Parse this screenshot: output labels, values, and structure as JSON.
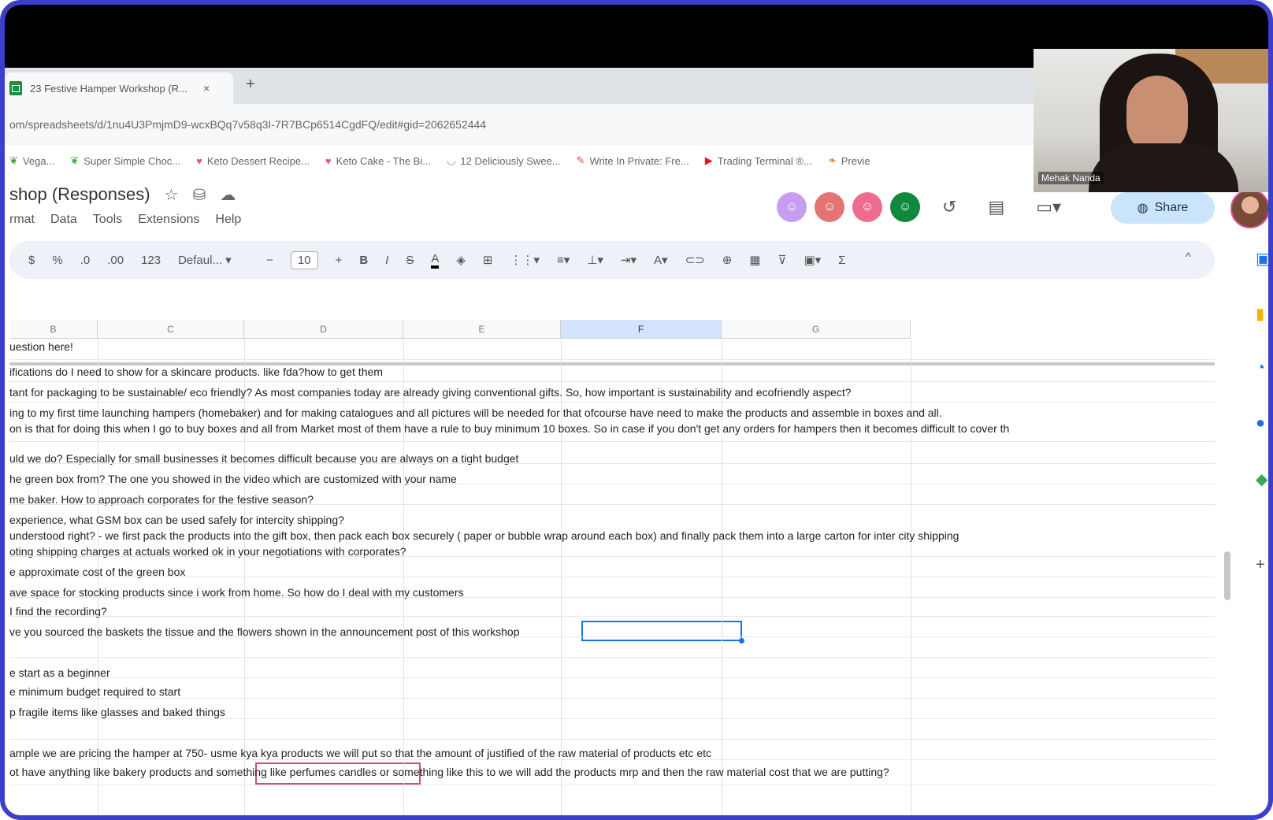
{
  "browser": {
    "tab_title": "23 Festive Hamper Workshop (R...",
    "tab_close": "×",
    "new_tab": "+",
    "url": "om/spreadsheets/d/1nu4U3PmjmD9-wcxBQq7v58q3I-7R7BCp6514CgdFQ/edit#gid=2062652444",
    "bookmarks": [
      {
        "icon": "leaf-icon",
        "label": "Vega...",
        "color": "#4a9d3c"
      },
      {
        "icon": "leaf-icon",
        "label": "Super Simple Choc...",
        "color": "#3bb03b"
      },
      {
        "icon": "heart-icon",
        "label": "Keto Dessert Recipe...",
        "color": "#e0569a"
      },
      {
        "icon": "heart-icon",
        "label": "Keto Cake - The Bi...",
        "color": "#e0569a"
      },
      {
        "icon": "bowl-icon",
        "label": "12 Deliciously Swee...",
        "color": "#888888"
      },
      {
        "icon": "pen-icon",
        "label": "Write In Private: Fre...",
        "color": "#e64a2e"
      },
      {
        "icon": "youtube-icon",
        "label": "Trading Terminal ®...",
        "color": "#e31b1b"
      },
      {
        "icon": "flame-icon",
        "label": "Previe",
        "color": "#f07b1c"
      }
    ]
  },
  "sheet": {
    "title": "shop (Responses)",
    "menus": [
      "rmat",
      "Data",
      "Tools",
      "Extensions",
      "Help"
    ],
    "share_label": "Share",
    "collaborators": [
      {
        "icon": "avatar-icon",
        "color": "#c79df1"
      },
      {
        "icon": "avatar-icon",
        "color": "#e57373"
      },
      {
        "icon": "avatar-icon",
        "color": "#ef6c8f"
      },
      {
        "icon": "avatar-icon",
        "color": "#0f8a3c"
      }
    ],
    "toolbar": {
      "currency": "$",
      "percent": "%",
      "number_format": "123",
      "font": "Defaul...",
      "font_size": "10",
      "minus": "−",
      "plus": "+",
      "bold": "B",
      "italic": "I",
      "strike": "S",
      "text_color": "A",
      "sum": "Σ",
      "collapse": "^"
    },
    "columns": [
      "B",
      "C",
      "D",
      "E",
      "F",
      "G"
    ],
    "selected_column": "F",
    "rows": [
      "uestion here!",
      "ifications do I need to show for a skincare products. like fda?how to get them",
      "tant for packaging to be sustainable/ eco friendly? As most companies today are already giving conventional gifts. So,  how important is sustainability and ecofriendly aspect?",
      "ing to my first time launching hampers (homebaker) and for making catalogues and all pictures will be needed for that ofcourse have need to make the products and assemble in boxes and all.",
      "on is that for doing this when I go to buy boxes and all from Market most of them have a rule to buy minimum 10 boxes. So in case if you don't get any orders for hampers then it becomes difficult to cover th",
      "uld we do? Especially for small businesses it becomes difficult because you are always on a tight budget",
      "he green box from? The one you showed in the video which are customized with your name",
      "me baker. How to approach corporates for the festive season?",
      "experience, what GSM box can be used safely for intercity shipping?",
      "understood right? - we first pack the products into the gift box, then pack each box securely ( paper or bubble wrap around each box) and finally pack them into a large carton for inter city shipping",
      "oting shipping charges at actuals worked ok in your negotiations with corporates?",
      "e approximate cost of the green box",
      "ave space for stocking products since i work from home. So how do I deal with my customers",
      "I find the recording?",
      "ve you sourced the baskets the tissue and the flowers shown in the announcement post of this workshop",
      "e start as a beginner",
      "e minimum budget required to start",
      "p fragile items like glasses and baked things",
      "ample we are pricing the hamper at 750- usme kya kya products we will put so that the amount of justified of the raw material of products etc etc",
      "ot have anything like bakery products and something like perfumes candles or something like this to we will add the products mrp and then the raw material cost that we are putting?"
    ]
  },
  "video": {
    "participant_name": "Mehak Nanda"
  },
  "colors": {
    "frame_border": "#3b3fc9",
    "selection_blue": "#1a73e8",
    "highlight_pink": "#d24a7a",
    "share_bg": "#c9e4fb"
  }
}
